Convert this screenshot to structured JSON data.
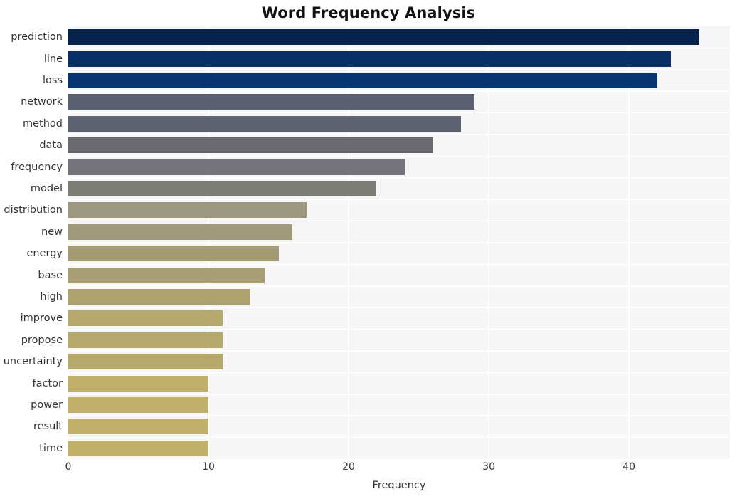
{
  "chart_data": {
    "type": "bar",
    "orientation": "horizontal",
    "title": "Word Frequency Analysis",
    "xlabel": "Frequency",
    "ylabel": "",
    "xlim": [
      0,
      47.2
    ],
    "ylim": [
      0,
      20
    ],
    "grid": true,
    "legend": null,
    "xticks": [
      0,
      10,
      20,
      30,
      40
    ],
    "xticklabels": [
      "0",
      "10",
      "20",
      "30",
      "40"
    ],
    "categories": [
      "prediction",
      "line",
      "loss",
      "network",
      "method",
      "data",
      "frequency",
      "model",
      "distribution",
      "new",
      "energy",
      "base",
      "high",
      "improve",
      "propose",
      "uncertainty",
      "factor",
      "power",
      "result",
      "time"
    ],
    "values": [
      45,
      43,
      42,
      29,
      28,
      26,
      24,
      22,
      17,
      16,
      15,
      14,
      13,
      11,
      11,
      11,
      10,
      10,
      10,
      10
    ],
    "bar_colors": [
      "#06244b",
      "#093066",
      "#063572",
      "#5b6072",
      "#5e6270",
      "#6a6a70",
      "#74747a",
      "#7d7d78",
      "#9c9781",
      "#a09a7c",
      "#a39b76",
      "#a69e74",
      "#ada26f",
      "#b5a86d",
      "#b5a86d",
      "#b5a86d",
      "#c0b06b",
      "#c0b06b",
      "#c0b06b",
      "#c0b06b"
    ],
    "plot_background": "#f6f6f7",
    "gridline_color": "#ffffff",
    "figure_background": "#ffffff"
  }
}
